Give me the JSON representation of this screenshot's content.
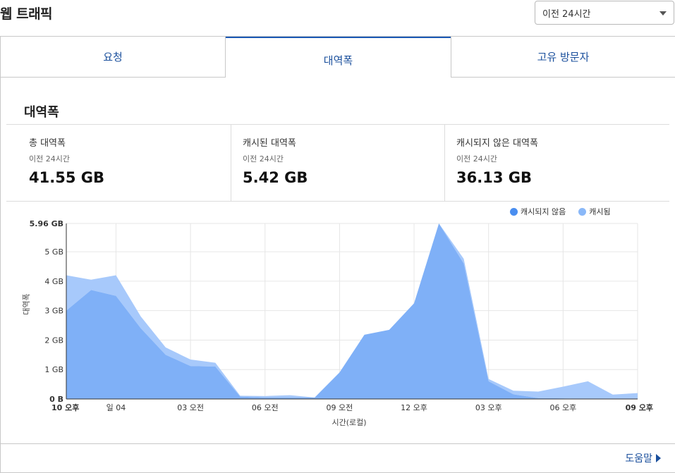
{
  "header": {
    "title": "웹 트래픽",
    "range_selected": "이전 24시간"
  },
  "tabs": [
    {
      "label": "요청"
    },
    {
      "label": "대역폭"
    },
    {
      "label": "고유 방문자"
    }
  ],
  "section": {
    "title": "대역폭"
  },
  "stats": [
    {
      "label": "총 대역폭",
      "sub": "이전 24시간",
      "value": "41.55 GB"
    },
    {
      "label": "캐시된 대역폭",
      "sub": "이전 24시간",
      "value": "5.42 GB"
    },
    {
      "label": "캐시되지 않은 대역폭",
      "sub": "이전 24시간",
      "value": "36.13 GB"
    }
  ],
  "footer": {
    "help_label": "도움말"
  },
  "colors": {
    "uncached": "#7fb0f7",
    "cached": "#a7c9fb",
    "legend_uncached": "#4a8ef0",
    "legend_cached": "#8ab8f8",
    "accent": "#1a58b4"
  },
  "chart_data": {
    "type": "area",
    "stacked": true,
    "ylabel": "대역폭",
    "xlabel": "시간(로컬)",
    "ylim": [
      0,
      5.96
    ],
    "yticks": [
      "0 B",
      "1 GB",
      "2 GB",
      "3 GB",
      "4 GB",
      "5 GB",
      "5.96 GB"
    ],
    "ytick_values": [
      0,
      1,
      2,
      3,
      4,
      5,
      5.96
    ],
    "xtick_labels": [
      "10 오후",
      "일 04",
      "03 오전",
      "06 오전",
      "09 오전",
      "12 오후",
      "03 오후",
      "06 오후",
      "09 오후"
    ],
    "xtick_hours": [
      0,
      2,
      5,
      8,
      11,
      14,
      17,
      20,
      23
    ],
    "grid": true,
    "legend": "top-right",
    "series": [
      {
        "name": "캐시되지 않음",
        "values": [
          3.0,
          3.7,
          3.5,
          2.4,
          1.5,
          1.12,
          1.1,
          0.08,
          0.05,
          0.05,
          0.05,
          0.9,
          2.18,
          2.35,
          3.25,
          5.96,
          4.6,
          0.6,
          0.16,
          0.03,
          0.02,
          0.0,
          0.0,
          0.0
        ]
      },
      {
        "name": "캐시됨",
        "values": [
          1.2,
          0.35,
          0.7,
          0.4,
          0.25,
          0.22,
          0.13,
          0.03,
          0.05,
          0.08,
          0.0,
          0.0,
          0.0,
          0.0,
          0.0,
          0.0,
          0.16,
          0.08,
          0.12,
          0.22,
          0.4,
          0.6,
          0.15,
          0.2
        ]
      }
    ],
    "x_hours": [
      0,
      1,
      2,
      3,
      4,
      5,
      6,
      7,
      8,
      9,
      10,
      11,
      12,
      13,
      14,
      15,
      16,
      17,
      18,
      19,
      20,
      21,
      22,
      23
    ]
  }
}
